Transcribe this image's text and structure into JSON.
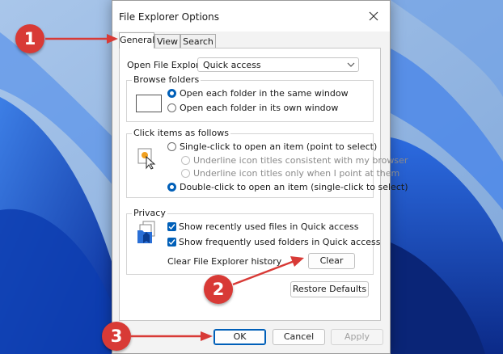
{
  "window": {
    "title": "File Explorer Options"
  },
  "tabs": [
    {
      "label": "General",
      "active": true
    },
    {
      "label": "View",
      "active": false
    },
    {
      "label": "Search",
      "active": false
    }
  ],
  "open_to": {
    "label": "Open File Explorer to:",
    "value": "Quick access"
  },
  "browse_folders": {
    "title": "Browse folders",
    "options": [
      {
        "label": "Open each folder in the same window",
        "checked": true
      },
      {
        "label": "Open each folder in its own window",
        "checked": false
      }
    ]
  },
  "click_items": {
    "title": "Click items as follows",
    "options": [
      {
        "label": "Single-click to open an item (point to select)",
        "checked": false
      },
      {
        "label": "Underline icon titles consistent with my browser",
        "checked": false,
        "disabled": true
      },
      {
        "label": "Underline icon titles only when I point at them",
        "checked": false,
        "disabled": true
      },
      {
        "label": "Double-click to open an item (single-click to select)",
        "checked": true
      }
    ]
  },
  "privacy": {
    "title": "Privacy",
    "options": [
      {
        "label": "Show recently used files in Quick access",
        "checked": true
      },
      {
        "label": "Show frequently used folders in Quick access",
        "checked": true
      }
    ],
    "clear_history_label": "Clear File Explorer history",
    "clear_button": "Clear"
  },
  "restore_defaults_button": "Restore Defaults",
  "footer": {
    "ok": "OK",
    "cancel": "Cancel",
    "apply": "Apply"
  },
  "annotations": {
    "step1": "1",
    "step2": "2",
    "step3": "3"
  },
  "colors": {
    "accent": "#005fb8",
    "annotation": "#d83a36"
  }
}
